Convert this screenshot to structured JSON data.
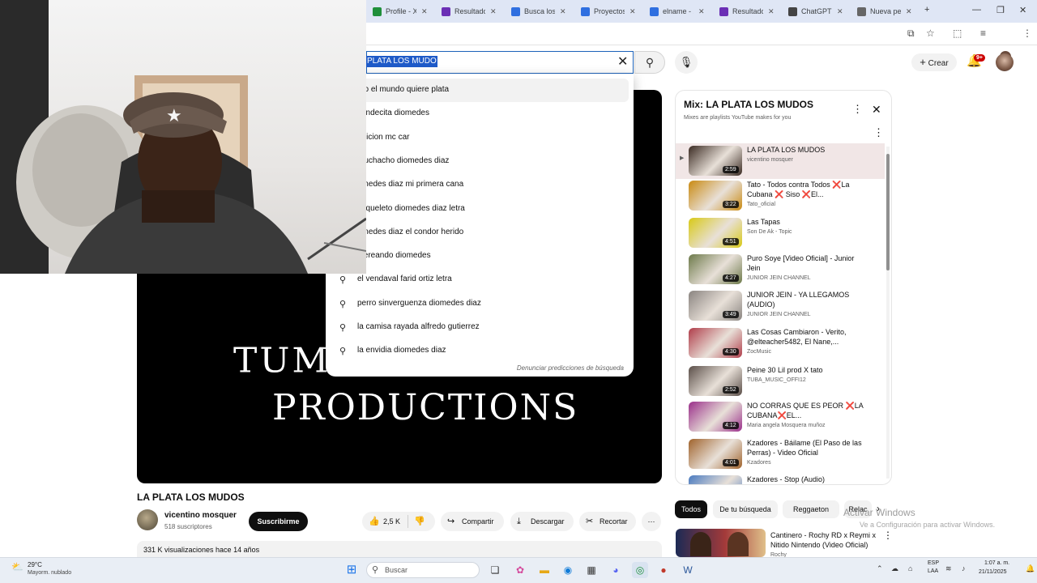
{
  "browser": {
    "tabs": [
      {
        "label": "Profile - X",
        "color": "#1f8f3a"
      },
      {
        "label": "Resultados",
        "color": "#6b2fb5"
      },
      {
        "label": "Busca los",
        "color": "#2f6fe0"
      },
      {
        "label": "Proyectos",
        "color": "#2f6fe0"
      },
      {
        "label": "elname - 2",
        "color": "#2f6fe0"
      },
      {
        "label": "Resultados",
        "color": "#6b2fb5"
      },
      {
        "label": "ChatGPT",
        "color": "#444444"
      },
      {
        "label": "Nueva pe",
        "color": "#666666"
      }
    ]
  },
  "header": {
    "search_query": "PLATA LOS MUDO",
    "create_label": "Crear",
    "notifications_badge": "9+"
  },
  "suggestions": {
    "items": [
      {
        "text": "do el mundo quiere plata",
        "icon": "search-icon"
      },
      {
        "text": "tiendecita diomedes",
        "icon": "search-icon"
      },
      {
        "text": "ndicion mc car",
        "icon": "search-icon"
      },
      {
        "text": "muchacho diomedes diaz",
        "icon": "search-icon"
      },
      {
        "text": "omedes diaz mi primera cana",
        "icon": "search-icon"
      },
      {
        "text": "esqueleto diomedes diaz letra",
        "icon": "search-icon"
      },
      {
        "text": "omedes diaz el condor herido",
        "icon": "search-icon"
      },
      {
        "text": "ujereando diomedes",
        "icon": "search-icon"
      },
      {
        "text": "el vendaval farid ortiz letra",
        "icon": "search-icon"
      },
      {
        "text": "perro sinverguenza diomedes diaz",
        "icon": "search-icon"
      },
      {
        "text": "la camisa rayada alfredo gutierrez",
        "icon": "search-icon"
      },
      {
        "text": "la envidia diomedes diaz",
        "icon": "search-icon"
      }
    ],
    "report_label": "Denunciar predicciones de búsqueda"
  },
  "player": {
    "logo_line1": "TUM",
    "logo_line2": "PRODUCTIONS"
  },
  "video": {
    "title": "LA PLATA LOS MUDOS",
    "channel_name": "vicentino mosquer",
    "subscribers": "518 suscriptores",
    "subscribe_label": "Suscribirme",
    "likes": "2,5 K",
    "share_label": "Compartir",
    "download_label": "Descargar",
    "clip_label": "Recortar",
    "views_and_date": "331 K visualizaciones  hace 14 años"
  },
  "mix": {
    "title": "Mix: LA PLATA LOS MUDOS",
    "subtitle": "Mixes are playlists YouTube makes for you",
    "items": [
      {
        "title": "LA PLATA LOS MUDOS",
        "author": "vicentino mosquer",
        "duration": "2:59",
        "current": true,
        "thumb": "#3a2a22"
      },
      {
        "title": "Tato - Todos contra Todos ❌La Cubana ❌ Siso ❌El...",
        "author": "Tato_oficial",
        "duration": "3:22",
        "current": false,
        "thumb": "#c98a12"
      },
      {
        "title": "Las Tapas",
        "author": "Son De Ak - Topic",
        "duration": "4:51",
        "current": false,
        "thumb": "#d8c916"
      },
      {
        "title": "Puro Soye [Video Oficial] - Junior Jein",
        "author": "JUNIOR JEIN CHANNEL",
        "duration": "4:27",
        "current": false,
        "thumb": "#6d7a4a"
      },
      {
        "title": "JUNIOR JEIN - YA LLEGAMOS (AUDIO)",
        "author": "JUNIOR JEIN CHANNEL",
        "duration": "3:49",
        "current": false,
        "thumb": "#8a8480"
      },
      {
        "title": "Las Cosas Cambiaron - Verito, @elteacher5482, El Nane,...",
        "author": "ZocMusic",
        "duration": "4:30",
        "current": false,
        "thumb": "#b03d4a"
      },
      {
        "title": "Peine 30 Lil prod X tato",
        "author": "TUBA_MUSIC_OFFI12",
        "duration": "2:52",
        "current": false,
        "thumb": "#5a4e48"
      },
      {
        "title": "NO CORRAS QUE ES PEOR ❌LA CUBANA❌EL...",
        "author": "Maria angela Mosquera muñoz",
        "duration": "4:12",
        "current": false,
        "thumb": "#9a2f8a"
      },
      {
        "title": "Kzadores - Báilame (El Paso de las Perras) - Video Oficial",
        "author": "Kzadores",
        "duration": "4:01",
        "current": false,
        "thumb": "#a0632c"
      },
      {
        "title": "Kzadores - Stop (Audio)",
        "author": "",
        "duration": "",
        "current": false,
        "thumb": "#4a7bc0"
      }
    ]
  },
  "chips": [
    "Todos",
    "De tu búsqueda",
    "Reggaeton",
    "Relac"
  ],
  "related": {
    "title": "Cantinero - Rochy RD x Reymi x Nitido Nintendo (Video Oficial)",
    "author": "Rochy"
  },
  "watermark": {
    "line1": "Activar Windows",
    "line2": "Ve a Configuración para activar Windows."
  },
  "taskbar": {
    "weather_temp": "29°C",
    "weather_desc": "Mayorm. nublado",
    "search_placeholder": "Buscar",
    "lang": "ESP",
    "lang2": "LAA",
    "time": "1:07 a. m.",
    "date": "21/11/2025"
  }
}
